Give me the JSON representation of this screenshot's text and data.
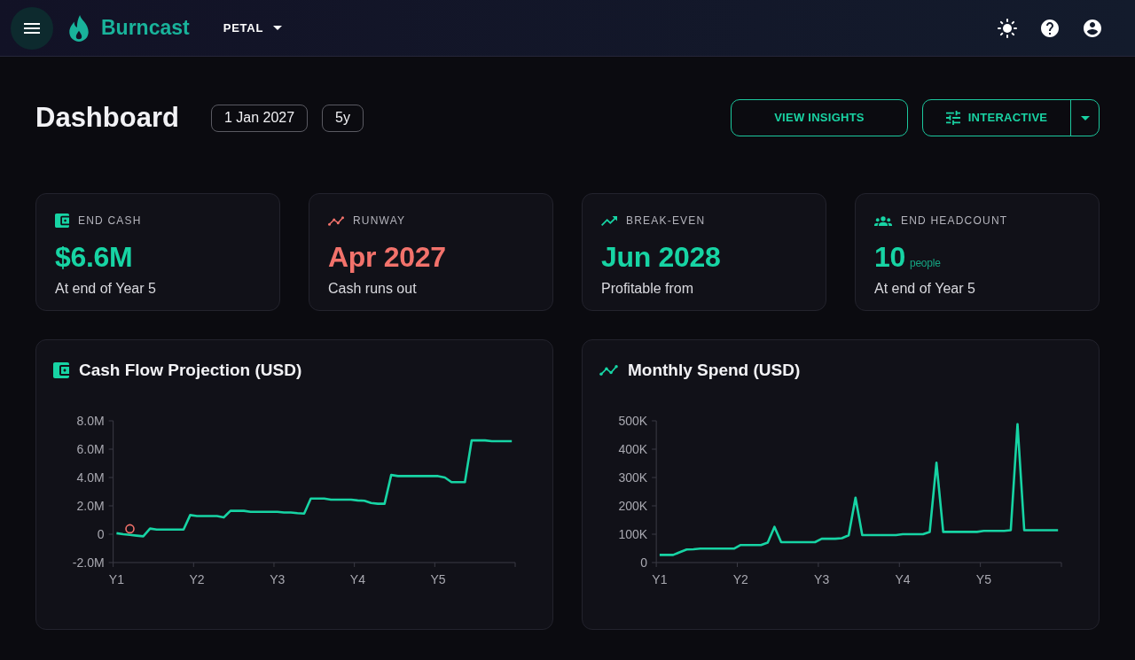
{
  "header": {
    "brand": "Burncast",
    "project": "PETAL"
  },
  "page": {
    "title": "Dashboard",
    "chips": [
      "1 Jan 2027",
      "5y"
    ],
    "actions": {
      "insights": "VIEW INSIGHTS",
      "mode": "INTERACTIVE"
    }
  },
  "kpis": [
    {
      "label": "END CASH",
      "value": "$6.6M",
      "caption": "At end of Year 5",
      "color": "#17d4a4"
    },
    {
      "label": "RUNWAY",
      "value": "Apr 2027",
      "caption": "Cash runs out",
      "color": "#f2726b"
    },
    {
      "label": "BREAK-EVEN",
      "value": "Jun 2028",
      "caption": "Profitable from",
      "color": "#17d4a4"
    },
    {
      "label": "END HEADCOUNT",
      "value": "10",
      "unit": "people",
      "caption": "At end of Year 5",
      "color": "#17d4a4"
    }
  ],
  "charts": [
    {
      "title": "Cash Flow Projection (USD)",
      "chart_data": {
        "type": "line",
        "categories": [
          "Y1",
          null,
          null,
          null,
          null,
          null,
          null,
          null,
          null,
          null,
          null,
          null,
          "Y2",
          null,
          null,
          null,
          null,
          null,
          null,
          null,
          null,
          null,
          null,
          null,
          "Y3",
          null,
          null,
          null,
          null,
          null,
          null,
          null,
          null,
          null,
          null,
          null,
          "Y4",
          null,
          null,
          null,
          null,
          null,
          null,
          null,
          null,
          null,
          null,
          null,
          "Y5",
          null,
          null,
          null,
          null,
          null,
          null,
          null,
          null,
          null,
          null,
          null
        ],
        "series": [
          {
            "color": "#17d4a4",
            "values": [
              0.07,
              0.0,
              -0.05,
              -0.1,
              -0.15,
              0.4,
              0.33,
              0.33,
              0.33,
              0.33,
              0.33,
              1.35,
              1.28,
              1.28,
              1.28,
              1.28,
              1.18,
              1.65,
              1.65,
              1.65,
              1.58,
              1.58,
              1.58,
              1.58,
              1.58,
              1.53,
              1.53,
              1.48,
              1.45,
              2.52,
              2.52,
              2.52,
              2.44,
              2.44,
              2.44,
              2.44,
              2.38,
              2.36,
              2.2,
              2.15,
              2.15,
              4.18,
              4.1,
              4.1,
              4.1,
              4.1,
              4.1,
              4.1,
              4.1,
              4.0,
              3.67,
              3.67,
              3.67,
              6.62,
              6.62,
              6.62,
              6.56,
              6.56,
              6.56,
              6.56
            ]
          },
          {
            "color": "#f2726b",
            "marker": "circle",
            "values": [
              null,
              null,
              0.38,
              null,
              null,
              null,
              null,
              null,
              null,
              null,
              null,
              null,
              null,
              null,
              null,
              null,
              null,
              null,
              null,
              null,
              null,
              null,
              null,
              null,
              null,
              null,
              null,
              null,
              null,
              null,
              null,
              null,
              null,
              null,
              null,
              null,
              null,
              null,
              null,
              null,
              null,
              null,
              null,
              null,
              null,
              null,
              null,
              null,
              null,
              null,
              null,
              null,
              null,
              null,
              null,
              null,
              null,
              null,
              null,
              null
            ]
          }
        ],
        "ylim": [
          -2,
          8
        ],
        "yticks": [
          {
            "value": 8,
            "label": "8.0M"
          },
          {
            "value": 6,
            "label": "6.0M"
          },
          {
            "value": 4,
            "label": "4.0M"
          },
          {
            "value": 2,
            "label": "2.0M"
          },
          {
            "value": 0,
            "label": "0"
          },
          {
            "value": -2,
            "label": "-2.0M"
          }
        ]
      }
    },
    {
      "title": "Monthly Spend (USD)",
      "chart_data": {
        "type": "line",
        "categories": [
          "Y1",
          null,
          null,
          null,
          null,
          null,
          null,
          null,
          null,
          null,
          null,
          null,
          "Y2",
          null,
          null,
          null,
          null,
          null,
          null,
          null,
          null,
          null,
          null,
          null,
          "Y3",
          null,
          null,
          null,
          null,
          null,
          null,
          null,
          null,
          null,
          null,
          null,
          "Y4",
          null,
          null,
          null,
          null,
          null,
          null,
          null,
          null,
          null,
          null,
          null,
          "Y5",
          null,
          null,
          null,
          null,
          null,
          null,
          null,
          null,
          null,
          null,
          null
        ],
        "series": [
          {
            "color": "#17d4a4",
            "values": [
              27,
              27,
              27,
              37,
              46,
              47,
              49,
              49,
              49,
              49,
              49,
              49,
              62,
              62,
              62,
              62,
              70,
              126,
              72,
              72,
              72,
              72,
              72,
              72,
              84,
              84,
              84,
              86,
              96,
              229,
              97,
              97,
              97,
              97,
              97,
              97,
              100,
              100,
              100,
              100,
              108,
              352,
              108,
              108,
              108,
              108,
              108,
              108,
              112,
              112,
              112,
              112,
              114,
              488,
              114,
              114,
              114,
              114,
              114,
              114
            ]
          }
        ],
        "ylim": [
          0,
          500
        ],
        "yticks": [
          {
            "value": 500,
            "label": "500K"
          },
          {
            "value": 400,
            "label": "400K"
          },
          {
            "value": 300,
            "label": "300K"
          },
          {
            "value": 200,
            "label": "200K"
          },
          {
            "value": 100,
            "label": "100K"
          },
          {
            "value": 0,
            "label": "0"
          }
        ]
      }
    }
  ]
}
